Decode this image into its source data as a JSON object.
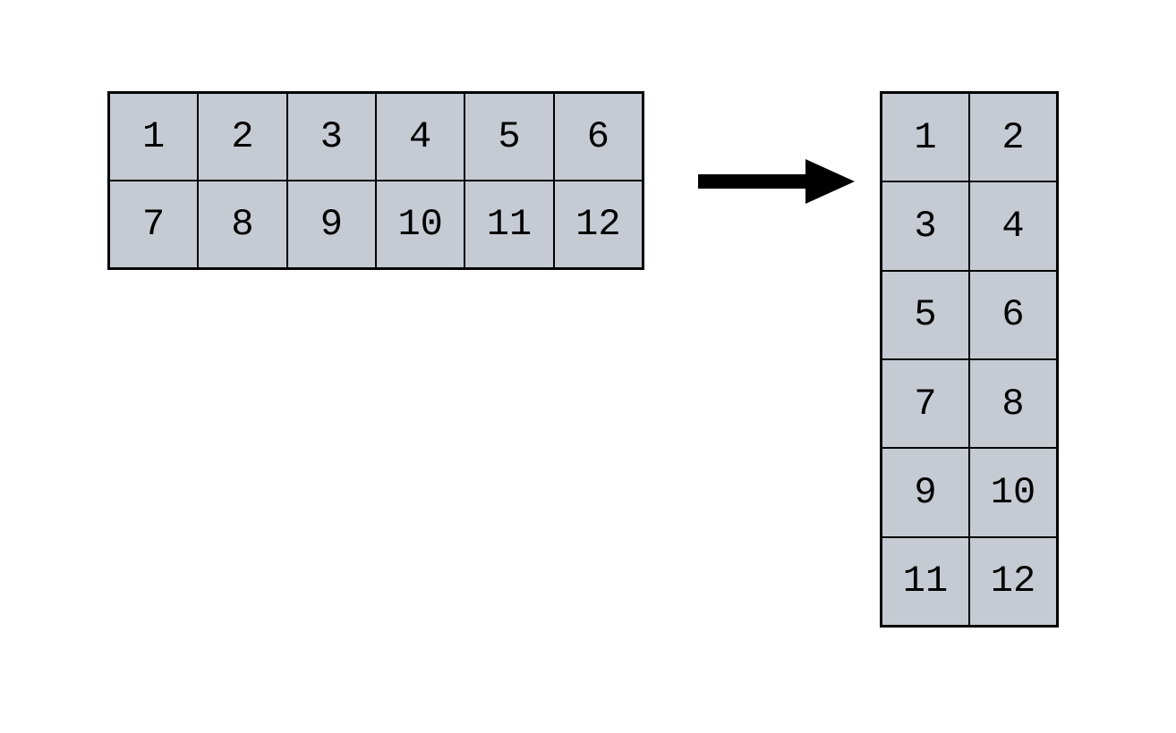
{
  "leftMatrix": {
    "rows": 2,
    "cols": 6,
    "cells": [
      "1",
      "2",
      "3",
      "4",
      "5",
      "6",
      "7",
      "8",
      "9",
      "10",
      "11",
      "12"
    ]
  },
  "rightMatrix": {
    "rows": 6,
    "cols": 2,
    "cells": [
      "1",
      "2",
      "3",
      "4",
      "5",
      "6",
      "7",
      "8",
      "9",
      "10",
      "11",
      "12"
    ]
  },
  "arrow": {
    "name": "arrow-right"
  },
  "colors": {
    "cellFill": "#c5cad3",
    "cellBorder": "#000000",
    "background": "#ffffff"
  }
}
